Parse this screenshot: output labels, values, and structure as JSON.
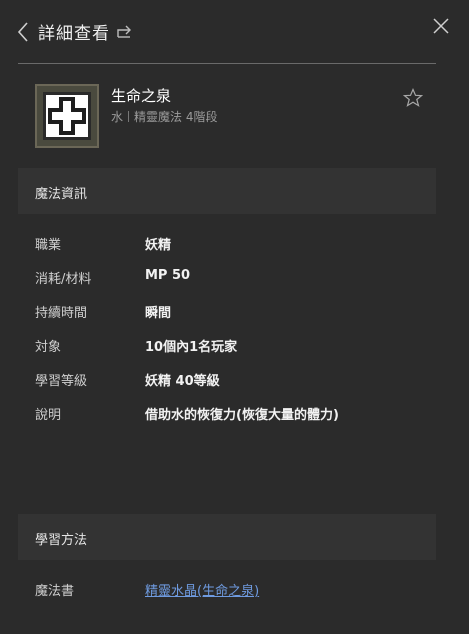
{
  "header": {
    "title": "詳細查看",
    "back_icon": "chevron-left-icon",
    "share_icon": "share-icon",
    "close_icon": "close-icon"
  },
  "item": {
    "name": "生命之泉",
    "element": "水",
    "category": "精靈魔法 4階段",
    "icon": "heal-cross-icon",
    "favorite_icon": "star-outline-icon"
  },
  "magic_info": {
    "section_title": "魔法資訊",
    "rows": [
      {
        "label": "職業",
        "value": "妖精"
      },
      {
        "label": "消耗/材料",
        "value": "MP 50"
      },
      {
        "label": "持續時間",
        "value": "瞬間"
      },
      {
        "label": "対象",
        "value": "10個內1名玩家"
      },
      {
        "label": "學習等級",
        "value": "妖精 40等級"
      },
      {
        "label": "說明",
        "value": "借助水的恢復力(恢復大量的體力)"
      }
    ]
  },
  "learn_method": {
    "section_title": "學習方法",
    "label": "魔法書",
    "link_text": "精靈水晶(生命之泉)"
  },
  "colors": {
    "background": "#2b2b2b",
    "section_bar": "#333333",
    "link": "#6f9be0"
  }
}
